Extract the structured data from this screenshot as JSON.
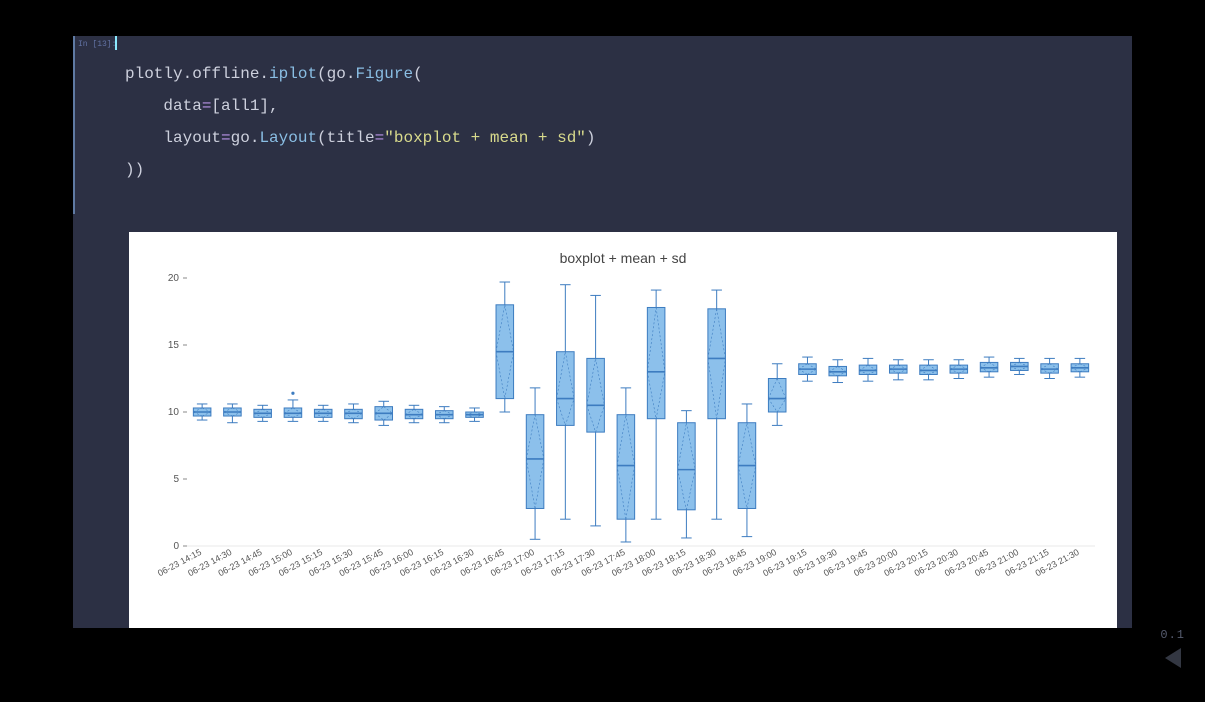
{
  "cell": {
    "prompt": "In [13]:",
    "tokens": [
      [
        {
          "t": "plotly",
          "c": "tok-mod"
        },
        {
          "t": ".offline.",
          "c": "tok-punc"
        },
        {
          "t": "iplot",
          "c": "tok-call"
        },
        {
          "t": "(go.",
          "c": "tok-punc"
        },
        {
          "t": "Figure",
          "c": "tok-call"
        },
        {
          "t": "(",
          "c": "tok-punc"
        }
      ],
      [
        {
          "t": "    data",
          "c": "tok-mod"
        },
        {
          "t": "=",
          "c": "tok-op"
        },
        {
          "t": "[all1],",
          "c": "tok-punc"
        }
      ],
      [
        {
          "t": "    layout",
          "c": "tok-mod"
        },
        {
          "t": "=",
          "c": "tok-op"
        },
        {
          "t": "go.",
          "c": "tok-punc"
        },
        {
          "t": "Layout",
          "c": "tok-call"
        },
        {
          "t": "(title",
          "c": "tok-punc"
        },
        {
          "t": "=",
          "c": "tok-op"
        },
        {
          "t": "\"boxplot + mean + sd\"",
          "c": "tok-str"
        },
        {
          "t": ")",
          "c": "tok-punc"
        }
      ],
      [
        {
          "t": "))",
          "c": "tok-punc"
        }
      ]
    ]
  },
  "version": "0.1",
  "chart_data": {
    "type": "box",
    "title": "boxplot + mean + sd",
    "ylabel": "",
    "xlabel": "",
    "ylim": [
      0,
      20
    ],
    "yticks": [
      0,
      5,
      10,
      15,
      20
    ],
    "categories": [
      "06-23 14:15",
      "06-23 14:30",
      "06-23 14:45",
      "06-23 15:00",
      "06-23 15:15",
      "06-23 15:30",
      "06-23 15:45",
      "06-23 16:00",
      "06-23 16:15",
      "06-23 16:30",
      "06-23 16:45",
      "06-23 17:00",
      "06-23 17:15",
      "06-23 17:30",
      "06-23 17:45",
      "06-23 18:00",
      "06-23 18:15",
      "06-23 18:30",
      "06-23 18:45",
      "06-23 19:00",
      "06-23 19:15",
      "06-23 19:30",
      "06-23 19:45",
      "06-23 20:00",
      "06-23 20:15",
      "06-23 20:30",
      "06-23 20:45",
      "06-23 21:00",
      "06-23 21:15",
      "06-23 21:30"
    ],
    "boxes": [
      {
        "min": 9.4,
        "q1": 9.7,
        "median": 10.0,
        "q3": 10.3,
        "max": 10.6,
        "outliers": []
      },
      {
        "min": 9.2,
        "q1": 9.7,
        "median": 10.0,
        "q3": 10.3,
        "max": 10.6,
        "outliers": []
      },
      {
        "min": 9.3,
        "q1": 9.6,
        "median": 9.9,
        "q3": 10.2,
        "max": 10.5,
        "outliers": []
      },
      {
        "min": 9.3,
        "q1": 9.6,
        "median": 9.9,
        "q3": 10.3,
        "max": 10.9,
        "outliers": [
          11.4
        ]
      },
      {
        "min": 9.3,
        "q1": 9.6,
        "median": 9.9,
        "q3": 10.2,
        "max": 10.5,
        "outliers": []
      },
      {
        "min": 9.2,
        "q1": 9.5,
        "median": 9.9,
        "q3": 10.2,
        "max": 10.6,
        "outliers": []
      },
      {
        "min": 9.0,
        "q1": 9.4,
        "median": 9.9,
        "q3": 10.4,
        "max": 10.8,
        "outliers": []
      },
      {
        "min": 9.2,
        "q1": 9.5,
        "median": 9.8,
        "q3": 10.2,
        "max": 10.5,
        "outliers": []
      },
      {
        "min": 9.2,
        "q1": 9.5,
        "median": 9.8,
        "q3": 10.1,
        "max": 10.4,
        "outliers": []
      },
      {
        "min": 9.3,
        "q1": 9.6,
        "median": 9.8,
        "q3": 10.0,
        "max": 10.3,
        "outliers": []
      },
      {
        "min": 10.0,
        "q1": 11.0,
        "median": 14.5,
        "q3": 18.0,
        "max": 19.7,
        "outliers": []
      },
      {
        "min": 0.5,
        "q1": 2.8,
        "median": 6.5,
        "q3": 9.8,
        "max": 11.8,
        "outliers": []
      },
      {
        "min": 2.0,
        "q1": 9.0,
        "median": 11.0,
        "q3": 14.5,
        "max": 19.5,
        "outliers": []
      },
      {
        "min": 1.5,
        "q1": 8.5,
        "median": 10.5,
        "q3": 14.0,
        "max": 18.7,
        "outliers": []
      },
      {
        "min": 0.3,
        "q1": 2.0,
        "median": 6.0,
        "q3": 9.8,
        "max": 11.8,
        "outliers": []
      },
      {
        "min": 2.0,
        "q1": 9.5,
        "median": 13.0,
        "q3": 17.8,
        "max": 19.1,
        "outliers": []
      },
      {
        "min": 0.6,
        "q1": 2.7,
        "median": 5.7,
        "q3": 9.2,
        "max": 10.1,
        "outliers": []
      },
      {
        "min": 2.0,
        "q1": 9.5,
        "median": 14.0,
        "q3": 17.7,
        "max": 19.1,
        "outliers": []
      },
      {
        "min": 0.7,
        "q1": 2.8,
        "median": 6.0,
        "q3": 9.2,
        "max": 10.6,
        "outliers": []
      },
      {
        "min": 9.0,
        "q1": 10.0,
        "median": 11.0,
        "q3": 12.5,
        "max": 13.6,
        "outliers": []
      },
      {
        "min": 12.3,
        "q1": 12.8,
        "median": 13.2,
        "q3": 13.6,
        "max": 14.1,
        "outliers": []
      },
      {
        "min": 12.2,
        "q1": 12.7,
        "median": 13.0,
        "q3": 13.4,
        "max": 13.9,
        "outliers": []
      },
      {
        "min": 12.3,
        "q1": 12.8,
        "median": 13.1,
        "q3": 13.5,
        "max": 14.0,
        "outliers": []
      },
      {
        "min": 12.4,
        "q1": 12.9,
        "median": 13.2,
        "q3": 13.5,
        "max": 13.9,
        "outliers": []
      },
      {
        "min": 12.4,
        "q1": 12.8,
        "median": 13.1,
        "q3": 13.5,
        "max": 13.9,
        "outliers": []
      },
      {
        "min": 12.5,
        "q1": 12.9,
        "median": 13.2,
        "q3": 13.5,
        "max": 13.9,
        "outliers": []
      },
      {
        "min": 12.6,
        "q1": 13.0,
        "median": 13.3,
        "q3": 13.7,
        "max": 14.1,
        "outliers": []
      },
      {
        "min": 12.8,
        "q1": 13.1,
        "median": 13.4,
        "q3": 13.7,
        "max": 14.0,
        "outliers": []
      },
      {
        "min": 12.5,
        "q1": 12.9,
        "median": 13.2,
        "q3": 13.6,
        "max": 14.0,
        "outliers": []
      },
      {
        "min": 12.6,
        "q1": 13.0,
        "median": 13.3,
        "q3": 13.6,
        "max": 14.0,
        "outliers": []
      }
    ],
    "color": {
      "fill": "#78b5e8",
      "stroke": "#3d7cc0"
    }
  }
}
